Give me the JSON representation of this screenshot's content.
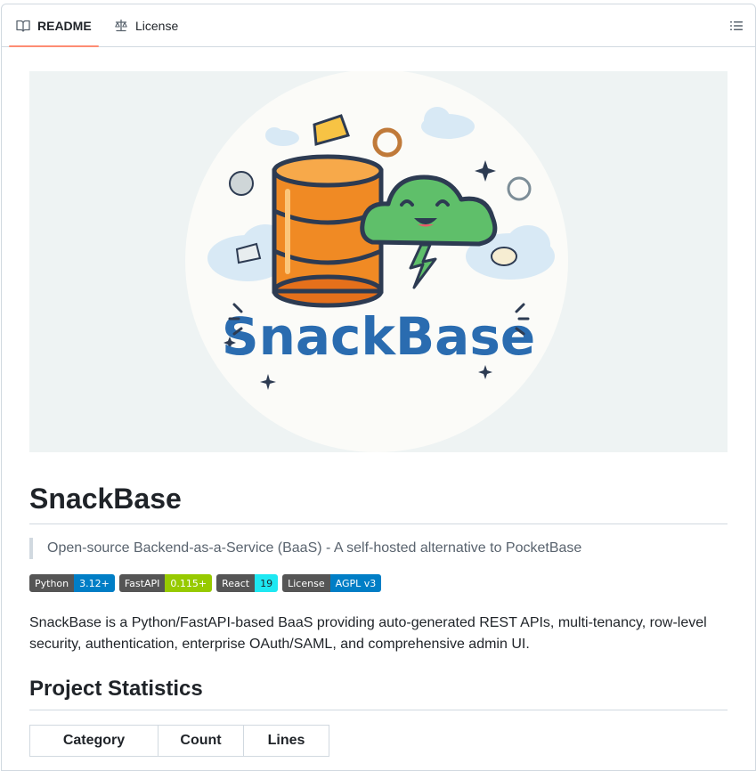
{
  "tabs": [
    {
      "label": "README",
      "icon": "book-icon",
      "active": true
    },
    {
      "label": "License",
      "icon": "law-scale-icon",
      "active": false
    }
  ],
  "toc_icon": "list-unordered-icon",
  "hero": {
    "logo_text": "SnackBase",
    "illustration": "database-cylinder-with-smiling-cloud-and-snacks"
  },
  "readme": {
    "title": "SnackBase",
    "tagline": "Open-source Backend-as-a-Service (BaaS) - A self-hosted alternative to PocketBase",
    "badges": [
      {
        "label": "Python",
        "value": "3.12+",
        "color": "#007ec6",
        "text_color": "#ffffff"
      },
      {
        "label": "FastAPI",
        "value": "0.115+",
        "color": "#97ca00",
        "text_color": "#ffffff"
      },
      {
        "label": "React",
        "value": "19",
        "color": "#1ee8f2",
        "text_color": "#1f2328"
      },
      {
        "label": "License",
        "value": "AGPL v3",
        "color": "#007ec6",
        "text_color": "#ffffff"
      }
    ],
    "description": "SnackBase is a Python/FastAPI-based BaaS providing auto-generated REST APIs, multi-tenancy, row-level security, authentication, enterprise OAuth/SAML, and comprehensive admin UI.",
    "stats_heading": "Project Statistics",
    "stats_columns": [
      "Category",
      "Count",
      "Lines"
    ]
  },
  "colors": {
    "active_tab_underline": "#fd8c73",
    "border": "#d1d9e0",
    "muted_text": "#59636e",
    "logo_blue": "#2a6cb0"
  }
}
